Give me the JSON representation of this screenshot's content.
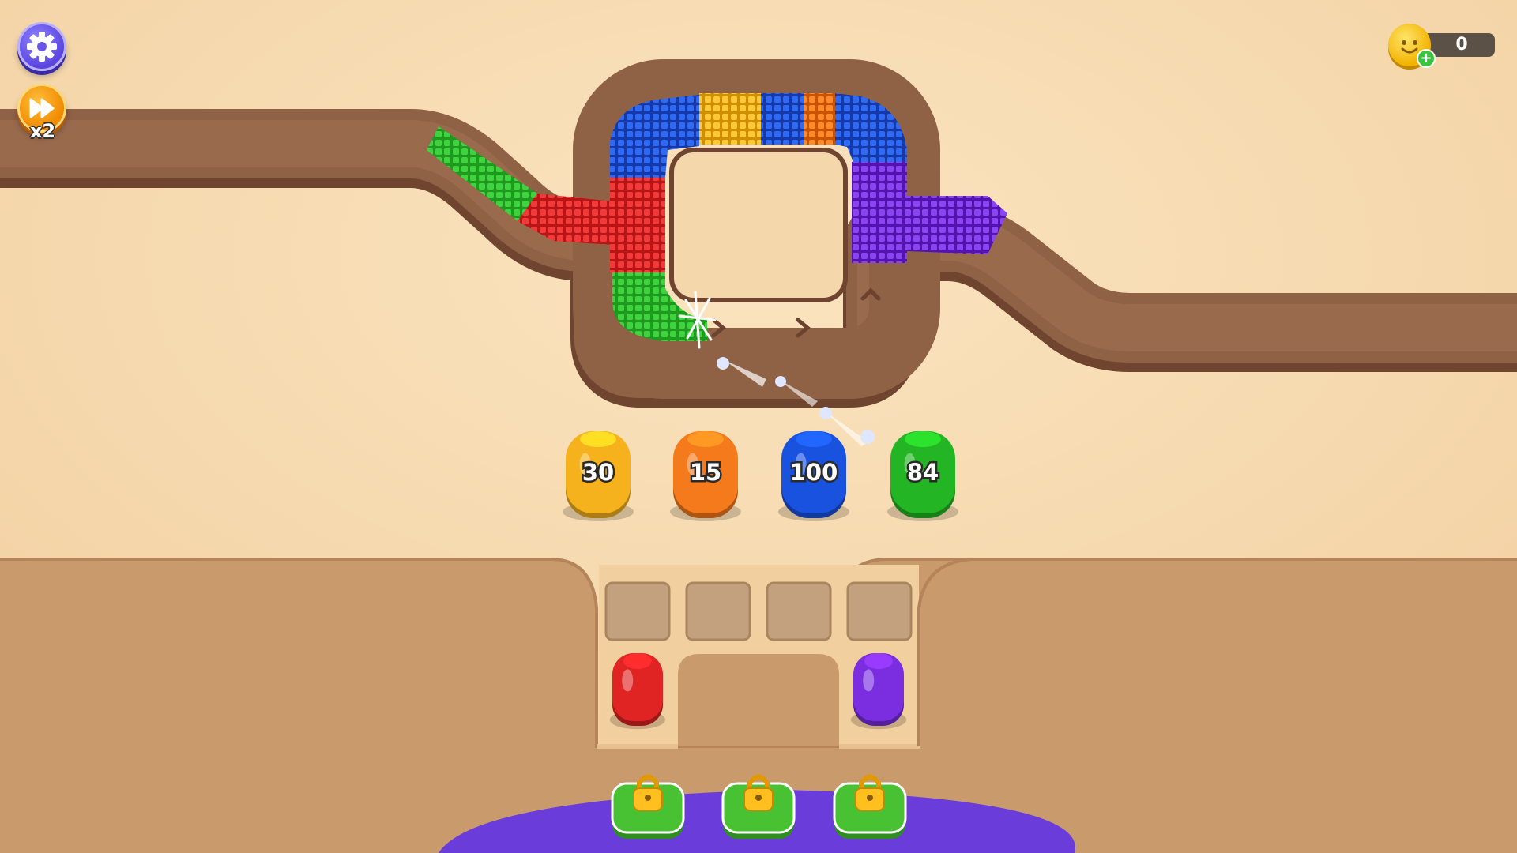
{
  "hud": {
    "speed_multiplier": "x2",
    "coins": "0",
    "settings_icon": "gear-icon",
    "speed_icon": "fast-forward-icon",
    "coin_icon": "smiling-coin-icon",
    "add_coins_icon": "plus-icon"
  },
  "shooters": [
    {
      "color": "#f5b21c",
      "count": "30"
    },
    {
      "color": "#f57a1c",
      "count": "15"
    },
    {
      "color": "#1a52e0",
      "count": "100"
    },
    {
      "color": "#23b523",
      "count": "84"
    }
  ],
  "queue_shooters": [
    {
      "color": "#e02424"
    },
    {
      "color": "#7a2ee0"
    }
  ],
  "locked_slots": [
    {
      "icon": "padlock-icon"
    },
    {
      "icon": "padlock-icon"
    },
    {
      "icon": "padlock-icon"
    }
  ],
  "conveyor_segments": [
    {
      "color": "green"
    },
    {
      "color": "red"
    },
    {
      "color": "blue"
    },
    {
      "color": "yellow"
    },
    {
      "color": "blue"
    },
    {
      "color": "orange"
    },
    {
      "color": "purple"
    }
  ],
  "colors": {
    "background": "#f6d9ae",
    "track": "#8f6145",
    "floor": "#c99a6c",
    "bottom_panel": "#6a3ddb",
    "green": "#23b523",
    "red": "#e02424",
    "blue": "#1a52e0",
    "yellow": "#f5b21c",
    "orange": "#f57a1c",
    "purple": "#7a2ee0"
  }
}
